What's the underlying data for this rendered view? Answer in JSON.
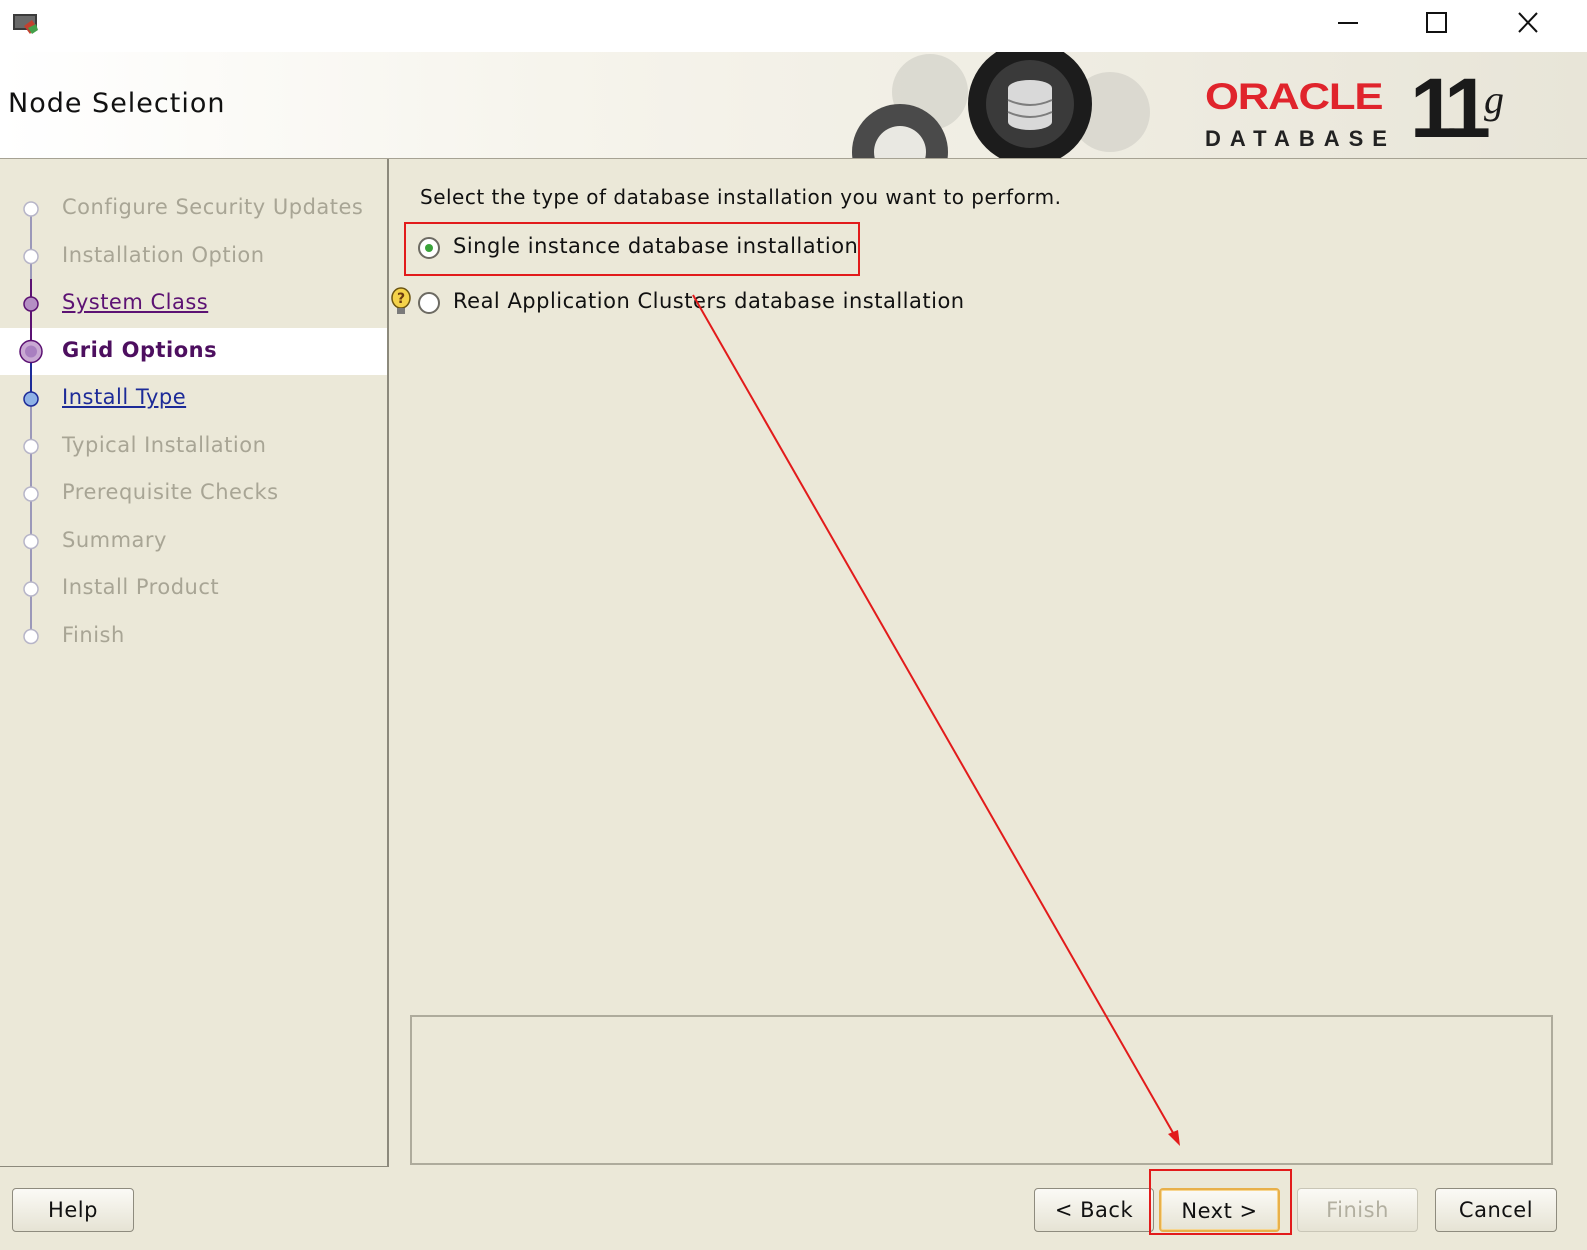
{
  "window": {
    "controls": [
      "minimize",
      "maximize",
      "close"
    ]
  },
  "header": {
    "title": "Node Selection",
    "logo_brand": "ORACLE",
    "logo_product": "DATABASE",
    "logo_version": "11",
    "logo_version_suffix": "g"
  },
  "steps": [
    {
      "label": "Configure Security Updates",
      "state": "disabled"
    },
    {
      "label": "Installation Option",
      "state": "disabled"
    },
    {
      "label": "System Class",
      "state": "visited"
    },
    {
      "label": "Grid Options",
      "state": "current"
    },
    {
      "label": "Install Type",
      "state": "visited"
    },
    {
      "label": "Typical Installation",
      "state": "disabled"
    },
    {
      "label": "Prerequisite Checks",
      "state": "disabled"
    },
    {
      "label": "Summary",
      "state": "disabled"
    },
    {
      "label": "Install Product",
      "state": "disabled"
    },
    {
      "label": "Finish",
      "state": "disabled"
    }
  ],
  "main": {
    "prompt": "Select the type of database installation you want to perform.",
    "options": [
      {
        "label": "Single instance database installation",
        "selected": true
      },
      {
        "label": "Real Application Clusters database installation",
        "selected": false
      }
    ],
    "message": ""
  },
  "buttons": {
    "help": "Help",
    "back": "< Back",
    "next": "Next >",
    "finish": "Finish",
    "cancel": "Cancel"
  },
  "colors": {
    "annotation": "#e21b1b",
    "selected_radio": "#3aa33a",
    "oracle_red": "#e0242c"
  }
}
